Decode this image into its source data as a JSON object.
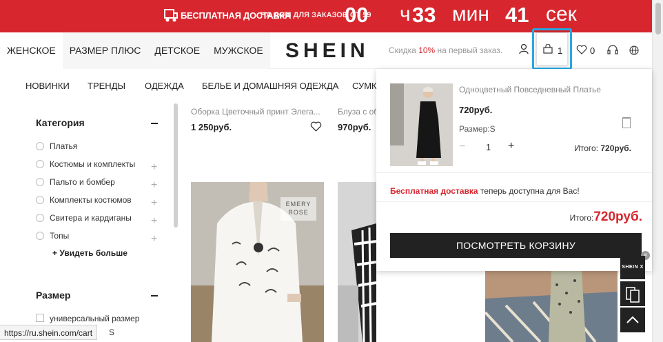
{
  "promo": {
    "free_shipping": "БЕСПЛАТНАЯ ДОСТАВКА",
    "condition": "НА ДОМ ДЛЯ ЗАКАЗОВ ОТ 59",
    "hours": "00",
    "hours_unit": "ч",
    "minutes": "33",
    "minutes_unit": "мин",
    "seconds": "41",
    "seconds_unit": "сек"
  },
  "header": {
    "categories": [
      "ЖЕНСКОЕ",
      "РАЗМЕР ПЛЮС",
      "ДЕТСКОЕ",
      "МУЖСКОЕ"
    ],
    "logo": "SHEIN",
    "discount_prefix": "Скидка",
    "discount_pct": "10%",
    "discount_suffix": "на первый заказ.",
    "cart_count": "1",
    "wishlist_count": "0"
  },
  "subnav": [
    "НОВИНКИ",
    "ТРЕНДЫ",
    "ОДЕЖДА",
    "БЕЛЬЕ И ДОМАШНЯЯ ОДЕЖДА",
    "СУМК"
  ],
  "sidebar": {
    "category_title": "Категория",
    "categories": [
      "Платья",
      "Костюмы и комплекты",
      "Пальто и бомбер",
      "Комплекты костюмов",
      "Свитера и кардиганы",
      "Топы"
    ],
    "see_more": "+ Увидеть больше",
    "size_title": "Размер",
    "size_option": "универсальный размер",
    "size_option2": "S"
  },
  "products": [
    {
      "name": "Оборка Цветочный принт Элега...",
      "price": "1 250руб."
    },
    {
      "name": "Блуза с об",
      "price": "970руб."
    }
  ],
  "product_image_text": "EMERY ROSE",
  "cart": {
    "item_name": "Одноцветный Повседневный Платье",
    "item_price": "720руб.",
    "item_size": "Размер:S",
    "item_qty": "1",
    "item_total_label": "Итого:",
    "item_total_value": "720руб.",
    "ship_red": "Бесплатная доставка",
    "ship_rest": "теперь доступна для Вас!",
    "total_label": "Итого:",
    "total_value": "720руб.",
    "view_cart": "ПОСМОТРЕТЬ КОРЗИНУ"
  },
  "floating": {
    "shein_x": "SHEIN X",
    "close": "×"
  },
  "status_url": "https://ru.shein.com/cart",
  "colors": {
    "brand_red": "#d7262e",
    "highlight": "#27a9e1",
    "dark": "#222222"
  }
}
